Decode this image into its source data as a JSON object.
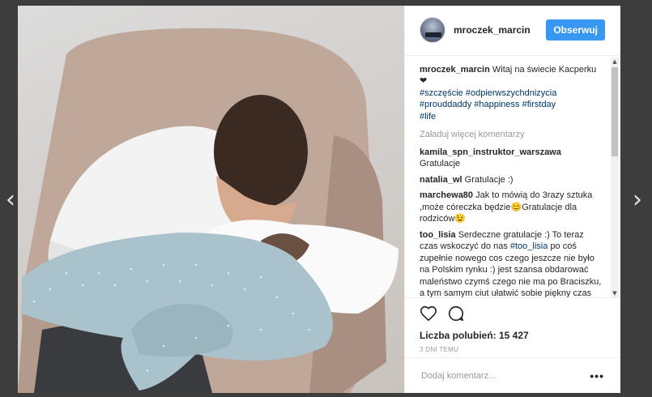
{
  "nav": {
    "prev_icon": "chevron-left-icon",
    "next_icon": "chevron-right-icon"
  },
  "post": {
    "username": "mroczek_marcin",
    "follow_label": "Obserwuj",
    "caption": {
      "user": "mroczek_marcin",
      "text": "Witaj na świecie Kacperku",
      "heart": "❤",
      "hashtags_line1": "#szczęście #odpierwszychdnizycia",
      "hashtags_line2": "#prouddaddy #happiness #firstday",
      "hashtags_line3": "#life"
    },
    "load_more": "Załaduj więcej komentarzy",
    "comments": [
      {
        "user": "kamila_spn_instruktor_warszawa",
        "text": "Gratulacje"
      },
      {
        "user": "natalia_wl",
        "text": "Gratulacje :)"
      },
      {
        "user": "marchewa80",
        "text": "Jak to mówią do 3razy sztuka ,może córeczka będzie😊Gratulacje dla rodziców😉"
      },
      {
        "user": "too_lisia",
        "text_before": "Serdeczne gratulacje :) To teraz czas wskoczyć do nas ",
        "tag": "#too_lisia",
        "text_after": " po coś zupełnie nowego cos czego jeszcze nie było na Polskim rynku :) jest szansa obdarować maleństwo czymś czego nie ma po Braciszku, a tym samym ciut ułatwić sobie piękny czas rodzicielstwa. ZaprasZamy na"
      }
    ],
    "likes": "Liczba polubień: 15 427",
    "time": "3 DNI TEMU",
    "add_comment_placeholder": "Dodaj komentarz...",
    "more_options": "•••",
    "colors": {
      "follow": "#3897f0",
      "hashtag": "#003569"
    }
  }
}
